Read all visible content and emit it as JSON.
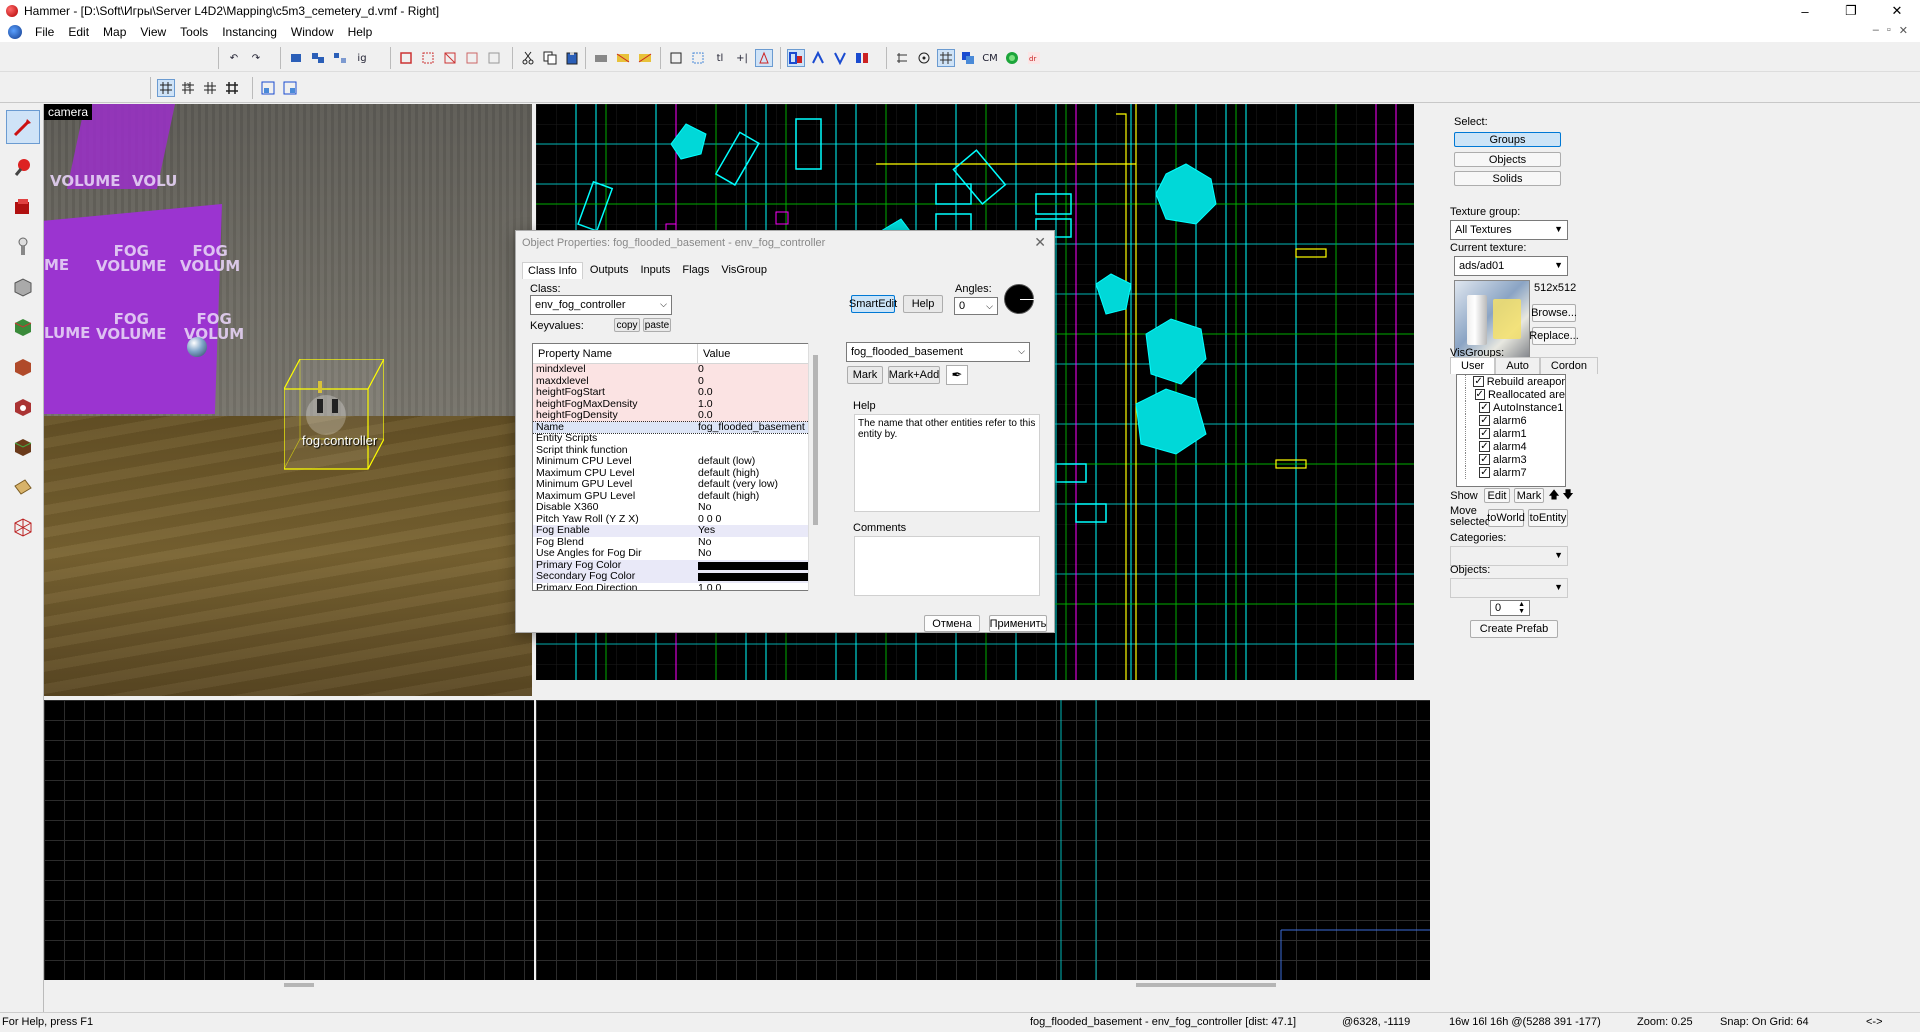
{
  "window": {
    "title": "Hammer - [D:\\Soft\\Игры\\Server L4D2\\Mapping\\c5m3_cemetery_d.vmf - Right]",
    "minimize": "–",
    "maximize": "❐",
    "close": "✕"
  },
  "menu": {
    "items": [
      "File",
      "Edit",
      "Map",
      "View",
      "Tools",
      "Instancing",
      "Window",
      "Help"
    ],
    "mdi_min": "–",
    "mdi_restore": "▫",
    "mdi_close": "✕"
  },
  "toolbar1": {
    "undo": "↶",
    "redo": "↷",
    "ig": "ig",
    "cm": "CM"
  },
  "camera_view": {
    "label": "camera",
    "entity_label": "fog.controller",
    "volume_texts": [
      "VOLUME",
      "VOLU",
      "FOG\nVOLUME",
      "FOG\nVOLUM",
      "FOG\nVOLUME",
      "FOG\nVOLUM",
      "ME",
      "LUME"
    ]
  },
  "right_panel": {
    "select_label": "Select:",
    "select_buttons": [
      "Groups",
      "Objects",
      "Solids"
    ],
    "selected_button": "Groups",
    "texture_group_label": "Texture group:",
    "texture_group_value": "All Textures",
    "current_texture_label": "Current texture:",
    "current_texture_value": "ads/ad01",
    "texture_size": "512x512",
    "browse_label": "Browse...",
    "replace_label": "Replace...",
    "visgroups_label": "VisGroups:",
    "visgroup_tabs": [
      "User",
      "Auto",
      "Cordon"
    ],
    "visgroups": [
      {
        "name": "Rebuild areapor",
        "checked": true
      },
      {
        "name": "Reallocated are",
        "checked": true
      },
      {
        "name": "AutoInstance1",
        "checked": true
      },
      {
        "name": "alarm6",
        "checked": true
      },
      {
        "name": "alarm1",
        "checked": true
      },
      {
        "name": "alarm4",
        "checked": true
      },
      {
        "name": "alarm3",
        "checked": true
      },
      {
        "name": "alarm7",
        "checked": true
      }
    ],
    "show_label": "Show",
    "edit_label": "Edit",
    "mark_label": "Mark",
    "move_selected_label": "Move\nselected:",
    "toworld_label": "toWorld",
    "toentity_label": "toEntity",
    "categories_label": "Categories:",
    "objects_label": "Objects:",
    "prefab_count": "0",
    "create_prefab_label": "Create Prefab"
  },
  "dialog": {
    "title": "Object Properties: fog_flooded_basement - env_fog_controller",
    "close": "✕",
    "tabs": [
      "Class Info",
      "Outputs",
      "Inputs",
      "Flags",
      "VisGroup"
    ],
    "active_tab": "Class Info",
    "class_label": "Class:",
    "class_value": "env_fog_controller",
    "keyvalues_label": "Keyvalues:",
    "copy_label": "copy",
    "paste_label": "paste",
    "smartedit_label": "SmartEdit",
    "help_button_label": "Help",
    "angles_label": "Angles:",
    "angles_value": "0",
    "grid_headers": [
      "Property Name",
      "Value"
    ],
    "properties": [
      {
        "name": "mindxlevel",
        "value": "0",
        "modified": true
      },
      {
        "name": "maxdxlevel",
        "value": "0",
        "modified": true
      },
      {
        "name": "heightFogStart",
        "value": "0.0",
        "modified": true
      },
      {
        "name": "heightFogMaxDensity",
        "value": "1.0",
        "modified": true
      },
      {
        "name": "heightFogDensity",
        "value": "0.0",
        "modified": true
      },
      {
        "name": "Name",
        "value": "fog_flooded_basement",
        "selected": true
      },
      {
        "name": "Entity Scripts",
        "value": ""
      },
      {
        "name": "Script think function",
        "value": ""
      },
      {
        "name": "Minimum CPU Level",
        "value": "default (low)"
      },
      {
        "name": "Maximum CPU Level",
        "value": "default (high)"
      },
      {
        "name": "Minimum GPU Level",
        "value": "default (very low)"
      },
      {
        "name": "Maximum GPU Level",
        "value": "default (high)"
      },
      {
        "name": "Disable X360",
        "value": "No"
      },
      {
        "name": "Pitch Yaw Roll (Y Z X)",
        "value": "0 0 0"
      },
      {
        "name": "Fog Enable",
        "value": "Yes",
        "color": true
      },
      {
        "name": "Fog Blend",
        "value": "No"
      },
      {
        "name": "Use Angles for Fog Dir",
        "value": "No"
      },
      {
        "name": "Primary Fog Color",
        "value": "",
        "swatch": "#000000",
        "color": true
      },
      {
        "name": "Secondary Fog Color",
        "value": "",
        "swatch": "#000000",
        "color": true
      },
      {
        "name": "Primary Fog Direction",
        "value": "1 0 0"
      }
    ],
    "edit_value": "fog_flooded_basement",
    "mark_label": "Mark",
    "mark_add_label": "Mark+Add",
    "help_section_label": "Help",
    "help_text": "The name that other entities refer to this entity by.",
    "comments_label": "Comments",
    "cancel_label": "Отмена",
    "apply_label": "Применить"
  },
  "statusbar": {
    "help": "For Help, press F1",
    "selection": "fog_flooded_basement - env_fog_controller  [dist: 47.1]",
    "coords": "@6328, -1119",
    "size": "16w 16l 16h @(5288 391 -177)",
    "zoom": "Zoom: 0.25",
    "snap": "Snap: On Grid: 64",
    "arrows": "<->"
  },
  "colors": {
    "wireframe_cyan": "#00ffff",
    "wireframe_green": "#00c000",
    "wireframe_yellow": "#ffff00",
    "wireframe_magenta": "#ff00ff",
    "fog_volume": "#9b34d0",
    "selection_yellow": "#ffff00"
  }
}
